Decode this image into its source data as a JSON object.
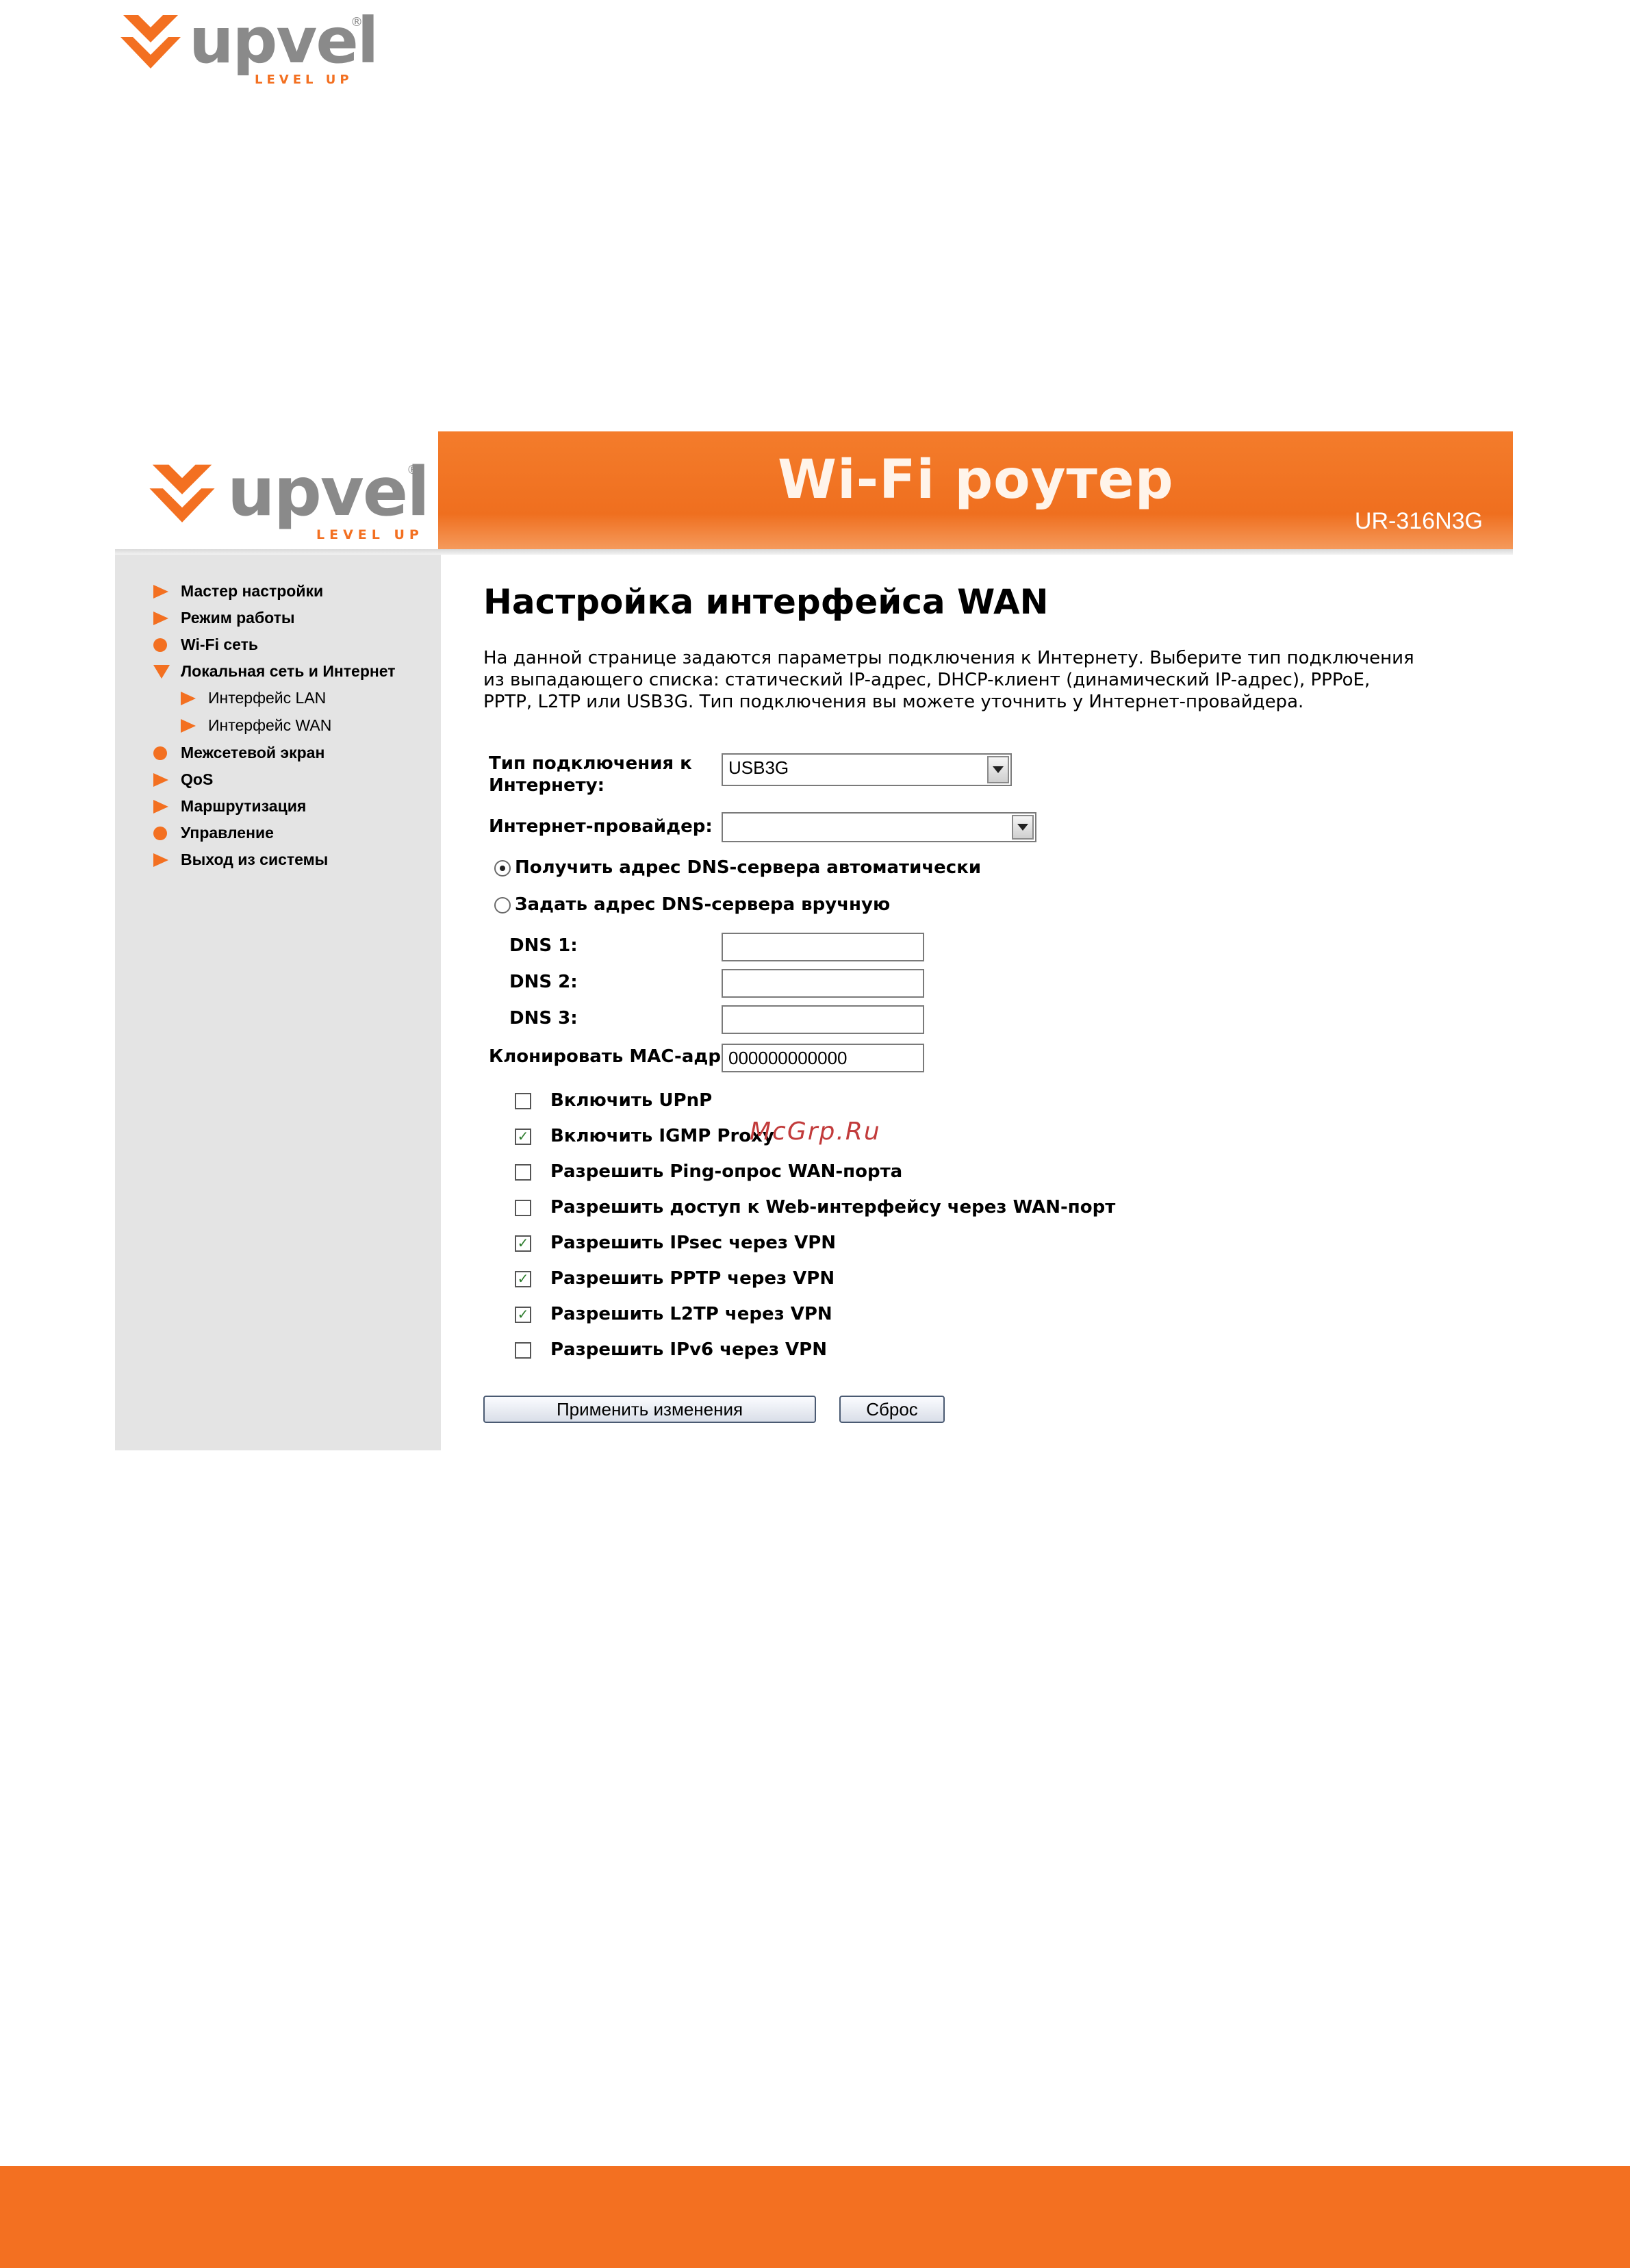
{
  "brand": {
    "name": "upvel",
    "tagline": "LEVEL UP",
    "registered": "®"
  },
  "header": {
    "title": "Wi-Fi роутер",
    "model": "UR-316N3G"
  },
  "sidebar": {
    "items": [
      {
        "label": "Мастер настройки",
        "icon": "arrow-right-icon"
      },
      {
        "label": "Режим работы",
        "icon": "arrow-right-icon"
      },
      {
        "label": "Wi-Fi сеть",
        "icon": "dot-icon"
      },
      {
        "label": "Локальная сеть и Интернет",
        "icon": "arrow-down-icon"
      },
      {
        "label": "Интерфейс LAN",
        "icon": "arrow-right-icon"
      },
      {
        "label": "Интерфейс WAN",
        "icon": "arrow-right-icon"
      },
      {
        "label": "Межсетевой экран",
        "icon": "dot-icon"
      },
      {
        "label": "QoS",
        "icon": "arrow-right-icon"
      },
      {
        "label": "Маршрутизация",
        "icon": "arrow-right-icon"
      },
      {
        "label": "Управление",
        "icon": "dot-icon"
      },
      {
        "label": "Выход из системы",
        "icon": "arrow-right-icon"
      }
    ]
  },
  "main": {
    "title": "Настройка интерфейса WAN",
    "description": [
      "На данной странице задаются параметры подключения к Интернету. Выберите тип подключения",
      "из выпадающего списка: статический IP-адрес, DHCP-клиент (динамический IP-адрес), PPPoE,",
      "PPTP, L2TP или USB3G. Тип подключения вы можете уточнить у Интернет-провайдера."
    ],
    "connection_type": {
      "label_line1": "Тип подключения к",
      "label_line2": "Интернету:",
      "value": "USB3G"
    },
    "provider": {
      "label": "Интернет-провайдер:",
      "value": ""
    },
    "dns_auto": {
      "label": "Получить адрес DNS-сервера автоматически",
      "checked": true
    },
    "dns_manual": {
      "label": "Задать адрес DNS-сервера вручную",
      "checked": false
    },
    "dns1": {
      "label": "DNS 1:",
      "value": ""
    },
    "dns2": {
      "label": "DNS 2:",
      "value": ""
    },
    "dns3": {
      "label": "DNS 3:",
      "value": ""
    },
    "mac_clone": {
      "label": "Клонировать MAC-адрес:",
      "value": "000000000000"
    },
    "options": [
      {
        "label": "Включить UPnP",
        "checked": false
      },
      {
        "label": "Включить IGMP Proxy",
        "checked": true
      },
      {
        "label": "Разрешить Ping-опрос WAN-порта",
        "checked": false
      },
      {
        "label": "Разрешить доступ к Web-интерфейсу через WAN-порт",
        "checked": false
      },
      {
        "label": "Разрешить IPsec через VPN",
        "checked": true
      },
      {
        "label": "Разрешить PPTP через VPN",
        "checked": true
      },
      {
        "label": "Разрешить L2TP через VPN",
        "checked": true
      },
      {
        "label": "Разрешить IPv6 через VPN",
        "checked": false
      }
    ],
    "apply_label": "Применить изменения",
    "reset_label": "Сброс",
    "check_glyph": "✓"
  },
  "watermark": "McGrp.Ru",
  "colors": {
    "accent": "#f37021",
    "sidebar_bg": "#e4e4e4",
    "logo_gray": "#8a8a8a"
  }
}
